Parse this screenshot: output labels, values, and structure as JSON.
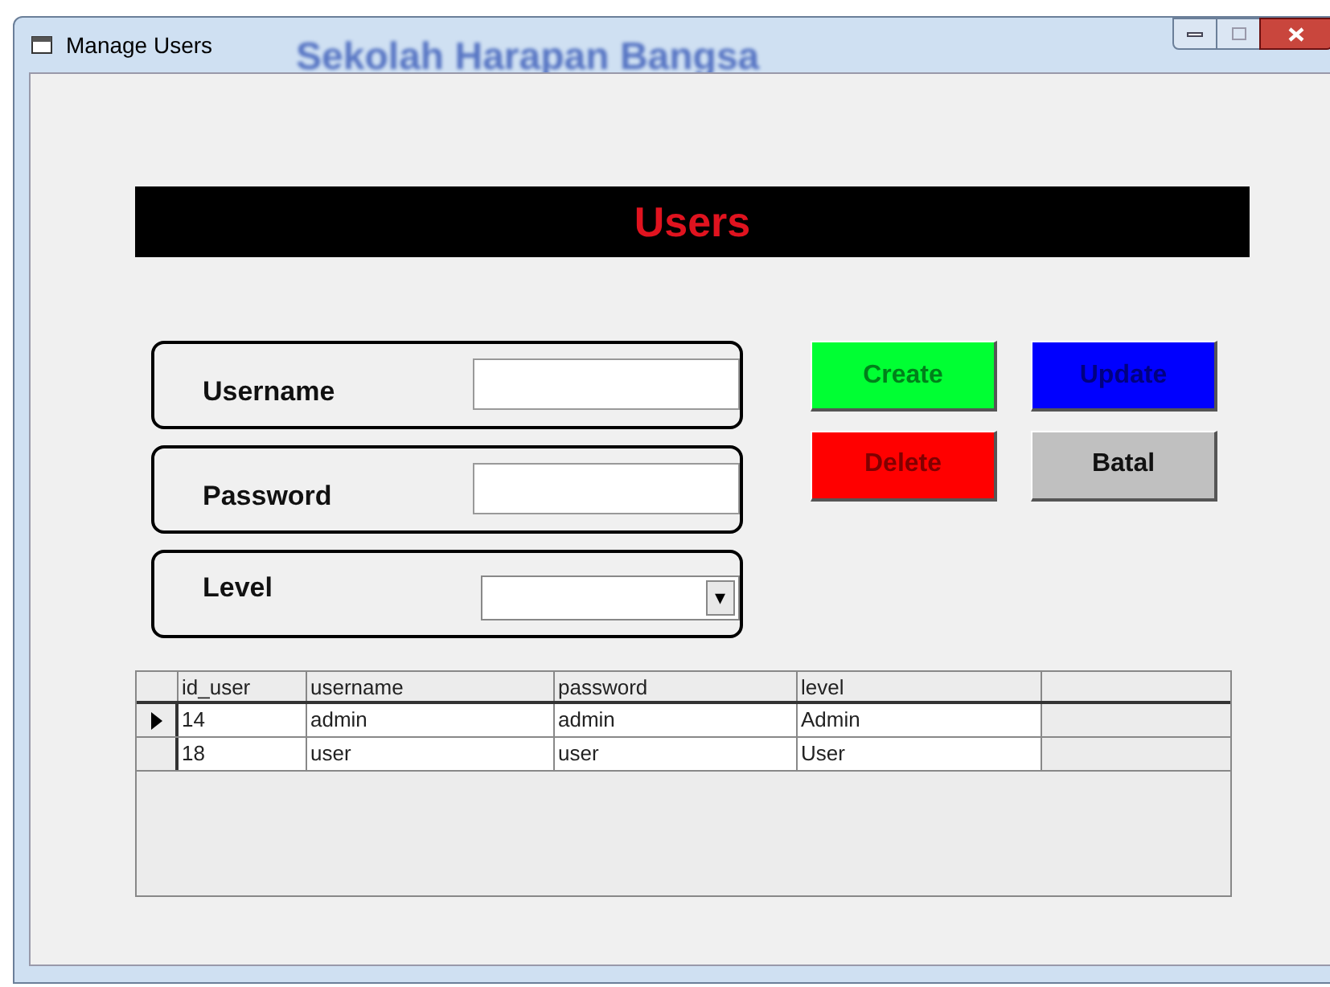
{
  "window": {
    "title": "Manage Users",
    "background_label": "Sekolah Harapan Bangsa"
  },
  "header": {
    "title": "Users"
  },
  "form": {
    "fields": [
      {
        "label": "Username",
        "kind": "text"
      },
      {
        "label": "Password",
        "kind": "text"
      },
      {
        "label": "Level",
        "kind": "dropdown",
        "arrow": "▾"
      }
    ]
  },
  "buttons": [
    {
      "label": "Create",
      "color": "#00ff33"
    },
    {
      "label": "Update",
      "color": "#0000ff"
    },
    {
      "label": "Delete",
      "color": "#ff0000"
    },
    {
      "label": "Batal",
      "color": "#c0c0c0"
    }
  ],
  "table": {
    "columns": [
      "id_user",
      "username",
      "password",
      "level"
    ],
    "rows": [
      {
        "cells": [
          "14",
          "admin",
          "admin",
          "Admin"
        ],
        "selected": true
      },
      {
        "cells": [
          "18",
          "user",
          "user",
          "User"
        ],
        "selected": false
      }
    ]
  }
}
